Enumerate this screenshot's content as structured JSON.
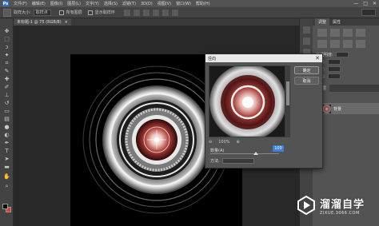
{
  "app": {
    "logo": "Ps",
    "menus": [
      "文件(F)",
      "编辑(E)",
      "图像(I)",
      "图层(L)",
      "文字(Y)",
      "选择(S)",
      "滤镜(T)",
      "3D(D)",
      "视图(V)",
      "窗口(W)",
      "帮助(H)"
    ],
    "window_controls": [
      "—",
      "□",
      "✕"
    ]
  },
  "options_bar": {
    "sample_label": "取样大小:",
    "sample_value": "取样点",
    "all_layers_label": "所有图层",
    "show_ring_label": "显示取样环"
  },
  "document": {
    "tab_label": "未标题-1 @ 75 (RGB/8)",
    "tab_close": "×"
  },
  "right_panel": {
    "tab_adjustments": "调整",
    "tab_properties": "属性",
    "prop_rows": [
      "不透明度:",
      "填充:",
      "角度:",
      "距离:"
    ],
    "layers_tab": "图层",
    "layer_name": "背景"
  },
  "dialog": {
    "title": "径向",
    "close": "✕",
    "ok_label": "确定",
    "cancel_label": "取消",
    "zoom_out": "⊖",
    "zoom_level": "100%",
    "zoom_in": "⊕",
    "amount_label": "数量(A)",
    "amount_value": "100",
    "method_label": "方法:"
  },
  "watermark": {
    "title": "溜溜自学",
    "subtitle": "ZIXUE.3066.COM"
  },
  "colors": {
    "accent": "#3f7fd8",
    "foreground": "#0a0a0a",
    "background": "#e23a2a"
  },
  "icons": [
    "move-icon",
    "marquee-icon",
    "lasso-icon",
    "magic-wand-icon",
    "crop-icon",
    "eyedropper-icon",
    "heal-icon",
    "brush-icon",
    "stamp-icon",
    "history-brush-icon",
    "eraser-icon",
    "gradient-icon",
    "blur-icon",
    "dodge-icon",
    "pen-icon",
    "type-icon",
    "path-select-icon",
    "shape-icon",
    "hand-icon",
    "zoom-icon"
  ]
}
